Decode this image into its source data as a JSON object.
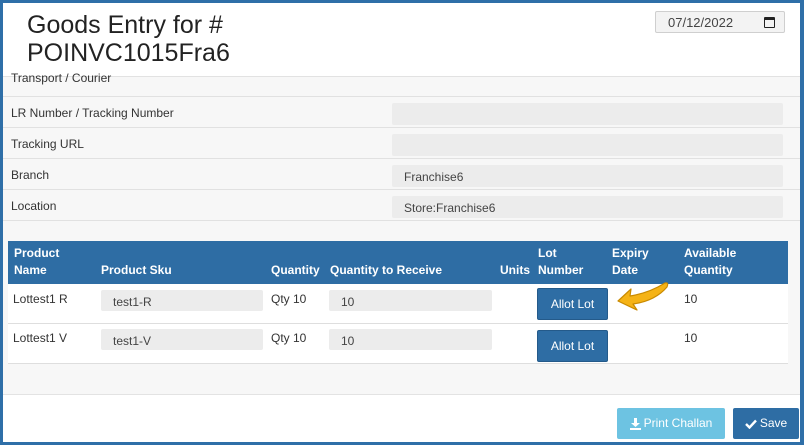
{
  "header": {
    "title": "Goods Entry for # POINVC1015Fra6",
    "date_value": "07/12/2022"
  },
  "info_rows": [
    {
      "label": "Transport / Courier",
      "value": ""
    },
    {
      "label": "LR Number / Tracking Number",
      "value": ""
    },
    {
      "label": "Tracking URL",
      "value": ""
    },
    {
      "label": "Branch",
      "value": "Franchise6"
    },
    {
      "label": "Location",
      "value": "Store:Franchise6"
    }
  ],
  "table": {
    "headers": {
      "product_name": "Product Name",
      "product_sku": "Product Sku",
      "quantity": "Quantity",
      "qty_to_receive": "Quantity to Receive",
      "units": "Units",
      "lot_number": "Lot Number",
      "expiry_date": "Expiry Date",
      "available_quantity": "Available Quantity"
    },
    "rows": [
      {
        "product_name": "Lottest1 R",
        "sku": "test1-R",
        "quantity": "Qty 10",
        "qty_to_receive": "10",
        "units": "",
        "lot_button": "Allot Lot",
        "expiry": "",
        "available": "10"
      },
      {
        "product_name": "Lottest1 V",
        "sku": "test1-V",
        "quantity": "Qty 10",
        "qty_to_receive": "10",
        "units": "",
        "lot_button": "Allot Lot",
        "expiry": "",
        "available": "10"
      }
    ]
  },
  "footer": {
    "print_label": "Print Challan",
    "save_label": "Save"
  },
  "icons": {
    "print": "download-icon",
    "save": "check-icon",
    "annotation": "arrow-left-icon"
  },
  "colors": {
    "header_blue": "#2e6da4",
    "print_button": "#6dc3e2",
    "annotation": "#f5b316"
  }
}
